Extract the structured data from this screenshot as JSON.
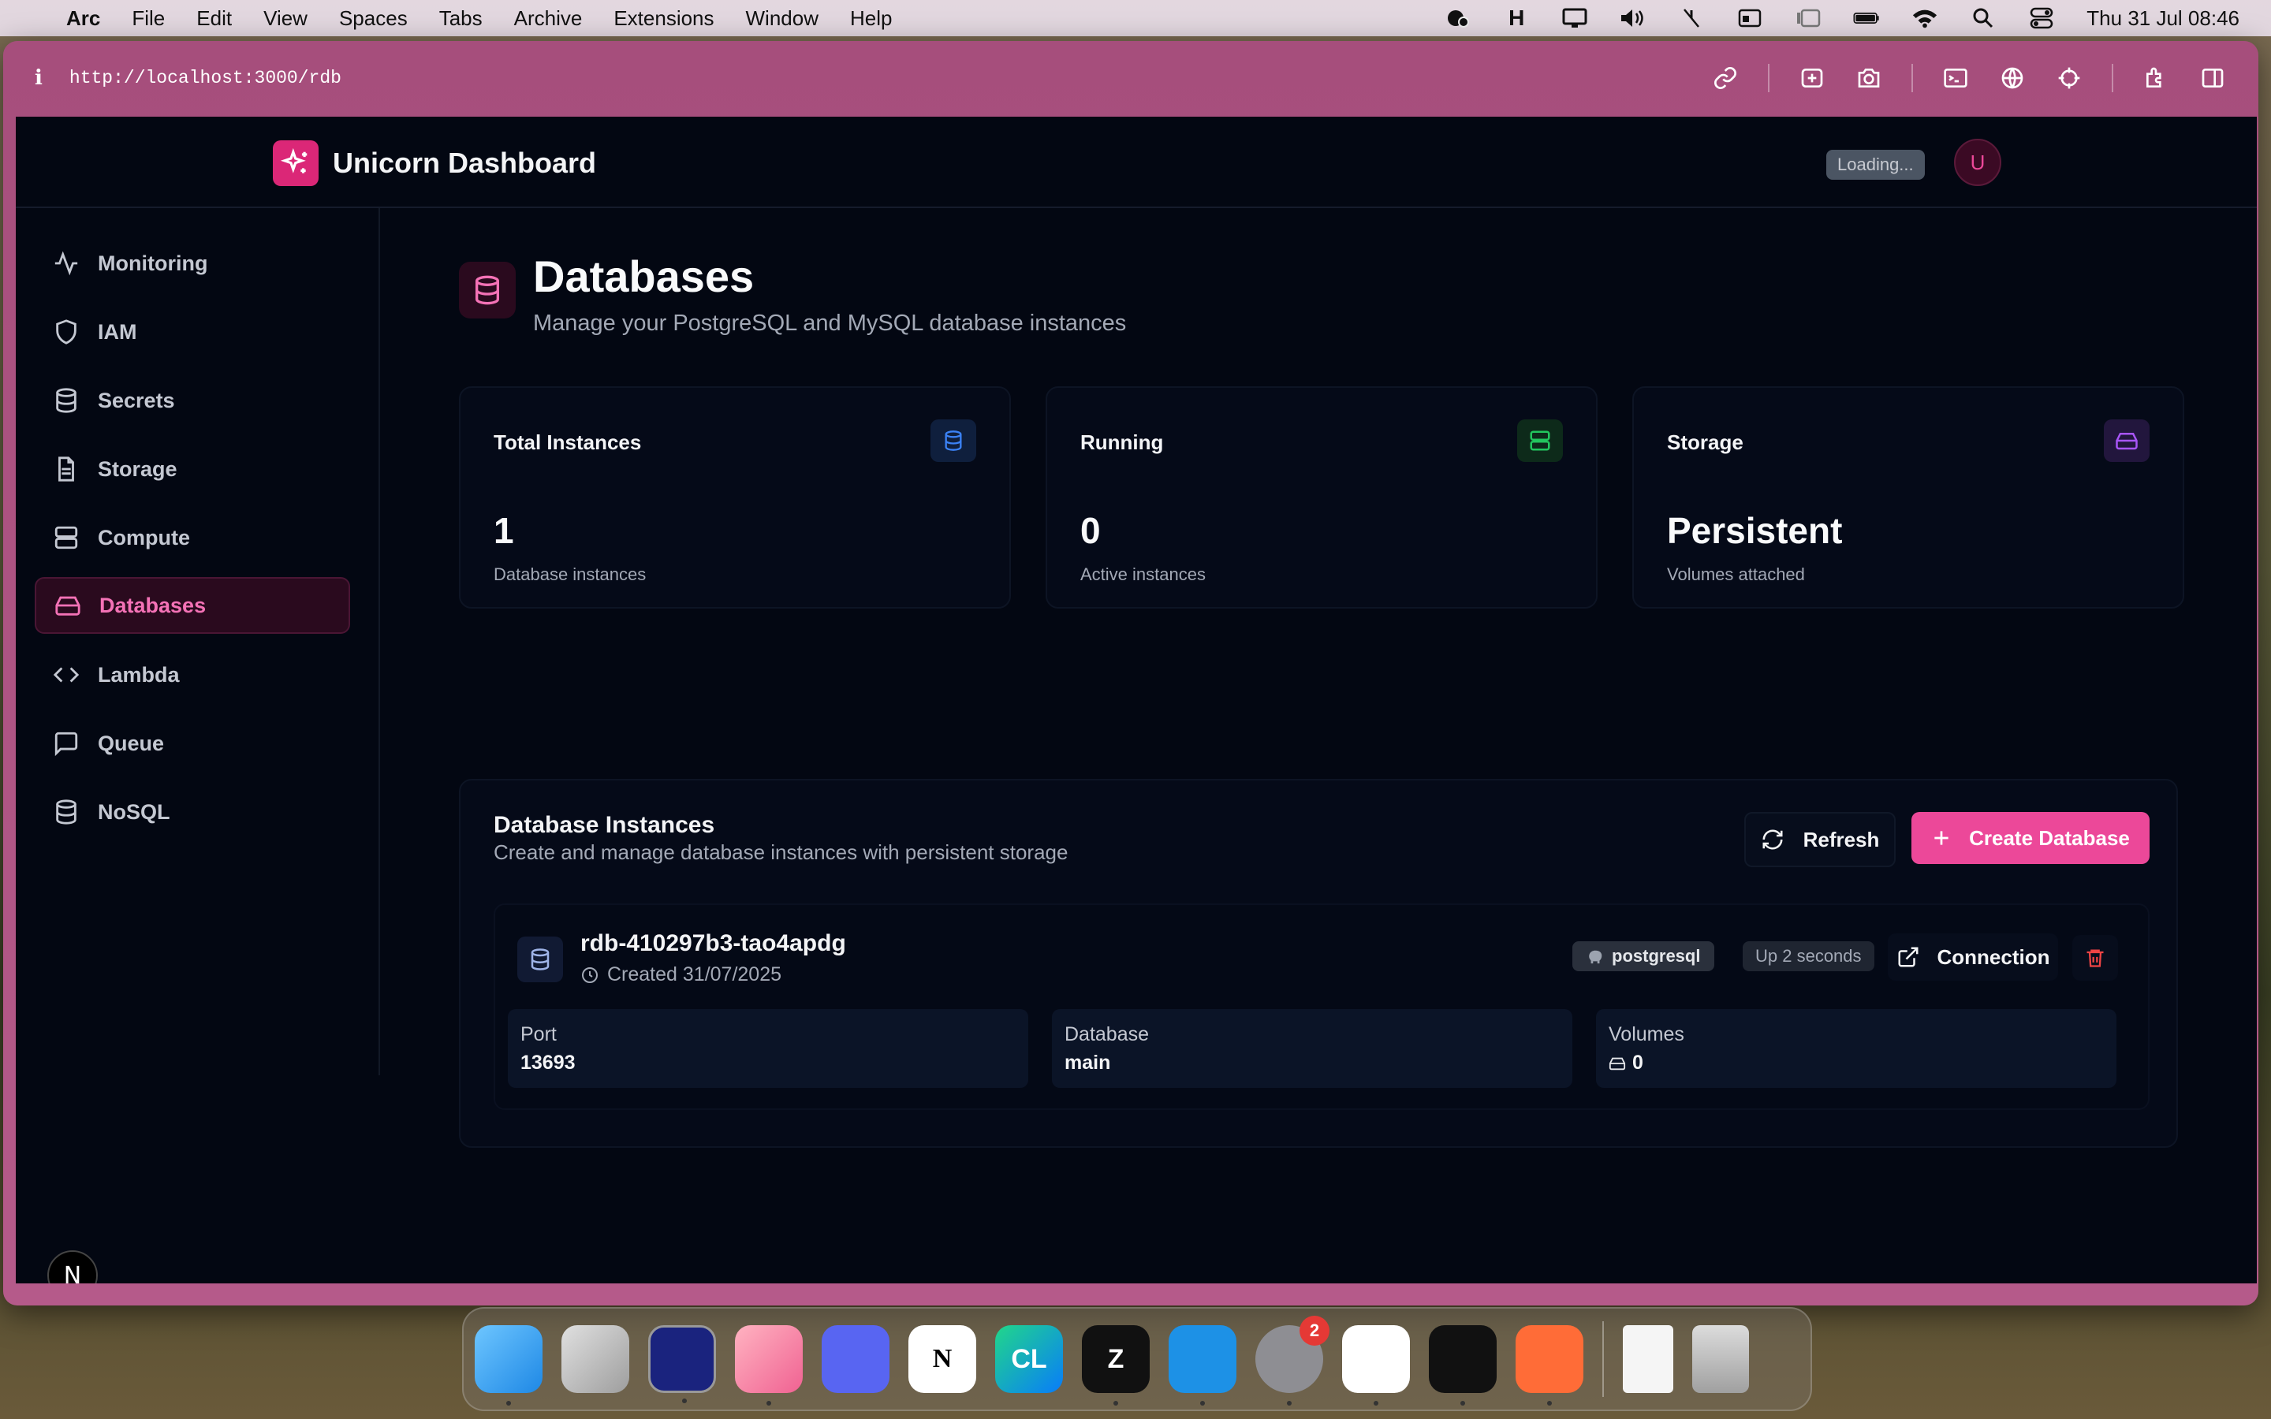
{
  "menubar": {
    "apple_symbol": "",
    "items": [
      "Arc",
      "File",
      "Edit",
      "View",
      "Spaces",
      "Tabs",
      "Archive",
      "Extensions",
      "Window",
      "Help"
    ],
    "clock": "Thu 31 Jul  08:46"
  },
  "browser": {
    "info_symbol": "i",
    "url": "http://localhost:3000/rdb"
  },
  "header": {
    "title": "Unicorn Dashboard",
    "loading": "Loading...",
    "avatar_initial": "U"
  },
  "sidebar": {
    "items": [
      {
        "label": "Monitoring",
        "icon": "activity-icon"
      },
      {
        "label": "IAM",
        "icon": "shield-icon"
      },
      {
        "label": "Secrets",
        "icon": "database-icon"
      },
      {
        "label": "Storage",
        "icon": "file-icon"
      },
      {
        "label": "Compute",
        "icon": "server-icon"
      },
      {
        "label": "Databases",
        "icon": "hard-drive-icon",
        "active": true
      },
      {
        "label": "Lambda",
        "icon": "code-icon"
      },
      {
        "label": "Queue",
        "icon": "message-square-icon"
      },
      {
        "label": "NoSQL",
        "icon": "database-icon"
      }
    ],
    "footer_badge": "N"
  },
  "page": {
    "title": "Databases",
    "subtitle": "Manage your PostgreSQL and MySQL database instances"
  },
  "stats": [
    {
      "label": "Total Instances",
      "value": "1",
      "sub": "Database instances",
      "icon": "database-icon",
      "color": "#3b82f6"
    },
    {
      "label": "Running",
      "value": "0",
      "sub": "Active instances",
      "icon": "server-icon",
      "color": "#22c55e"
    },
    {
      "label": "Storage",
      "value": "Persistent",
      "sub": "Volumes attached",
      "icon": "hard-drive-icon",
      "color": "#a855f7"
    }
  ],
  "instances": {
    "title": "Database Instances",
    "description": "Create and manage database instances with persistent storage",
    "refresh_label": "Refresh",
    "create_label": "Create Database",
    "items": [
      {
        "name": "rdb-410297b3-tao4apdg",
        "created": "Created 31/07/2025",
        "engine": "postgresql",
        "status": "Up 2 seconds",
        "connection_label": "Connection",
        "port_label": "Port",
        "port": "13693",
        "database_label": "Database",
        "database": "main",
        "volumes_label": "Volumes",
        "volumes": "0"
      }
    ]
  },
  "colors": {
    "accent": "#ec4899",
    "background": "#030712",
    "card": "#050a18",
    "danger": "#ef4444"
  },
  "dock": {
    "apps": [
      "Finder",
      "Launchpad",
      "Ghostty",
      "Arc",
      "Discord",
      "Notion",
      "CLion",
      "Zed",
      "Docker",
      "System Settings",
      "VS Code",
      "Cursor",
      "Postman",
      "Preview",
      "Trash"
    ],
    "settings_badge": "2"
  }
}
